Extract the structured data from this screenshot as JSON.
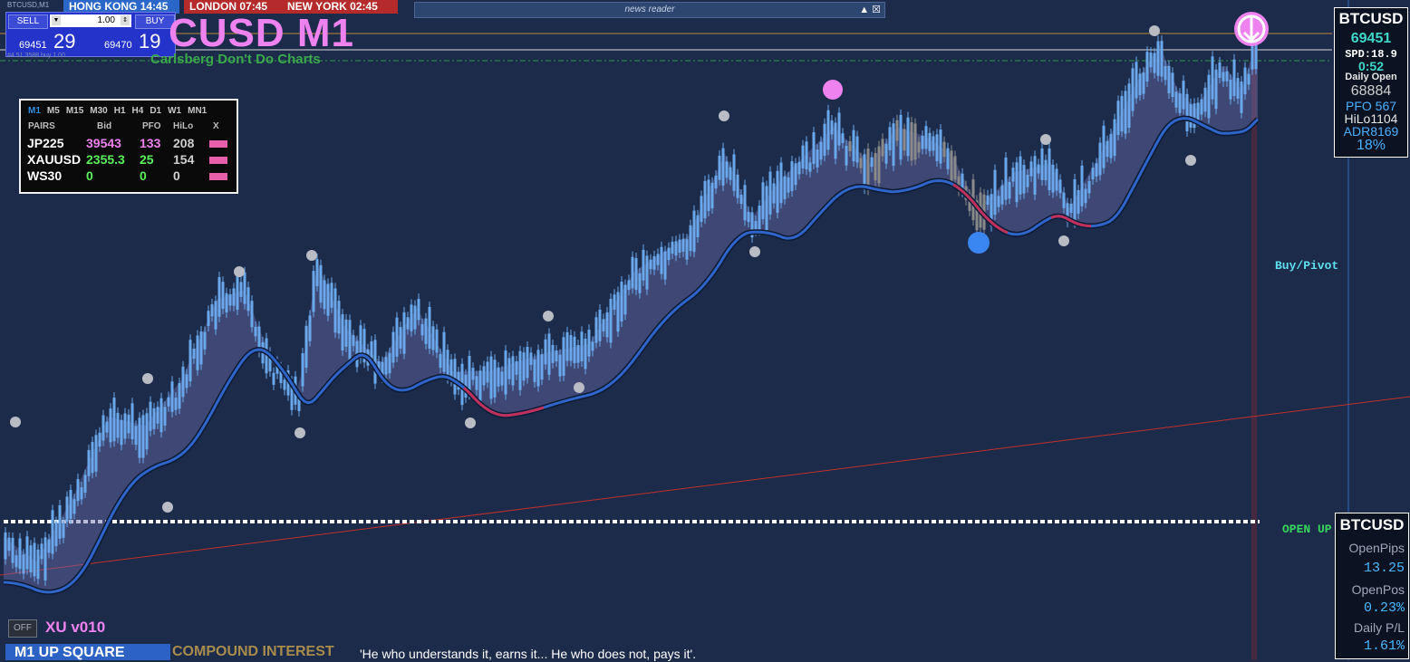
{
  "window": {
    "symbol_tab": "BTCUSD,M1"
  },
  "clocks": [
    {
      "city": "HONG KONG",
      "time": "14:45"
    },
    {
      "city": "LONDON",
      "time": "07:45"
    },
    {
      "city": "NEW YORK",
      "time": "02:45"
    }
  ],
  "news_reader": {
    "label": "news reader",
    "controls": "▲ ☒"
  },
  "one_click": {
    "sell_label": "SELL",
    "buy_label": "BUY",
    "lot": "1.00",
    "sell_small": "69451",
    "sell_big": "29",
    "buy_small": "69470",
    "buy_big": "19"
  },
  "chart": {
    "title": "CUSD M1",
    "subtitle": "Carlsberg Don't Do Charts",
    "tiny_label": "#4 51.3588 buy 1.00"
  },
  "pairs_panel": {
    "timeframes": [
      "M1",
      "M5",
      "M15",
      "M30",
      "H1",
      "H4",
      "D1",
      "W1",
      "MN1"
    ],
    "active_timeframe": "M1",
    "headers": [
      "PAIRS",
      "Bid",
      "PFO",
      "HiLo",
      "X"
    ],
    "rows": [
      {
        "pair": "JP225",
        "bid": "39543",
        "pfo": "133",
        "hilo": "208",
        "bid_color": "#ee82ee",
        "pfo_color": "#ee82ee"
      },
      {
        "pair": "XAUUSD",
        "bid": "2355.3",
        "pfo": "25",
        "hilo": "154",
        "bid_color": "#5cf05c",
        "pfo_color": "#5cf05c"
      },
      {
        "pair": "WS30",
        "bid": "0",
        "pfo": "0",
        "hilo": "0",
        "bid_color": "#5cf05c",
        "pfo_color": "#5cf05c"
      }
    ]
  },
  "price_box": {
    "symbol": "BTCUSD",
    "price": "69451",
    "spread": "SPD:18.9",
    "timer": "0:52",
    "daily_open_label": "Daily Open",
    "daily_open": "68884",
    "pfo": "PFO 567",
    "hilo": "HiLo1104",
    "adr": "ADR8169",
    "pct": "18%"
  },
  "labels": {
    "buy_pivot": "Buy/Pivot",
    "open_up": "OPEN UP"
  },
  "stats_box": {
    "symbol": "BTCUSD",
    "open_pips_label": "OpenPips",
    "open_pips": "13.25",
    "open_pos_label": "OpenPos",
    "open_pos": "0.23%",
    "daily_pl_label": "Daily P/L",
    "daily_pl": "1.61%"
  },
  "bottom": {
    "off_button": "OFF",
    "version": "XU v010",
    "signal": "M1  UP SQUARE",
    "compound": "COMPOUND INTEREST",
    "quote": "'He who understands it, earns it... He who does not, pays it'."
  },
  "colors": {
    "background": "#1c2b4a",
    "candle": "#6aa8ec",
    "candle_neutral": "#8a8a8a",
    "ma_line": "#2f64c8",
    "ma_bear": "#c0305a",
    "trend_line": "#c0302c",
    "pivot_line": "#ffffff"
  }
}
